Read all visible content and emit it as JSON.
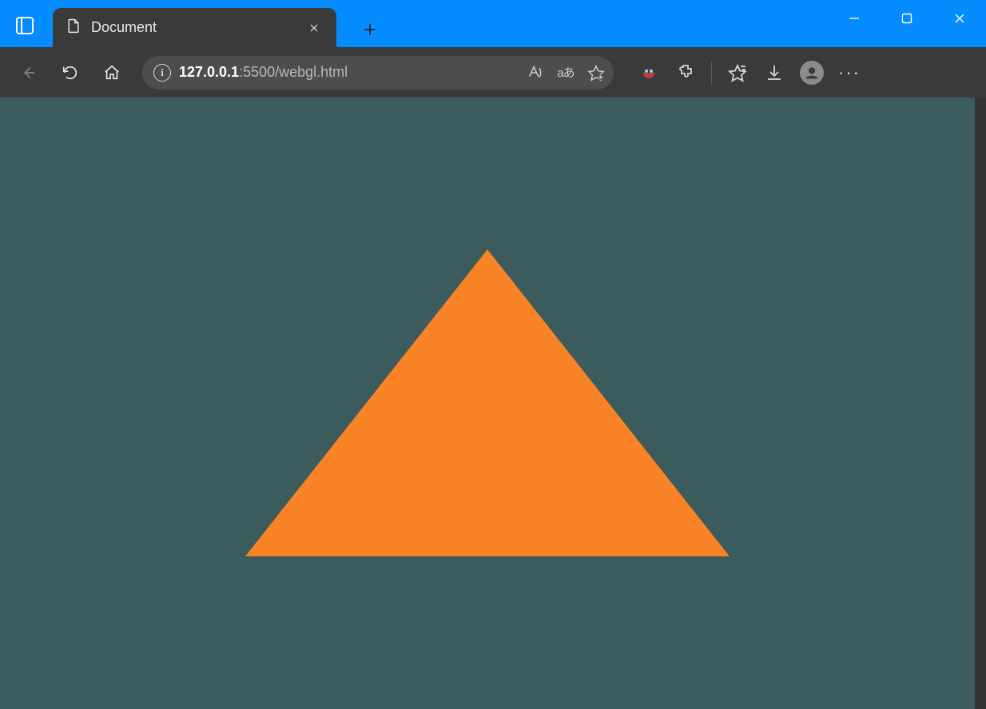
{
  "window": {
    "min_label": "Minimize",
    "max_label": "Maximize",
    "close_label": "Close"
  },
  "tab": {
    "title": "Document",
    "close_label": "Close tab",
    "new_tab_label": "New tab"
  },
  "toolbar": {
    "back_label": "Back",
    "refresh_label": "Refresh",
    "home_label": "Home",
    "info_glyph": "i",
    "read_aloud_label": "Read aloud",
    "translate_text": "aあ",
    "favorite_label": "Add to favorites",
    "bug_ext_label": "Extension",
    "extensions_label": "Extensions",
    "favorites_list_label": "Favorites",
    "downloads_label": "Downloads",
    "profile_label": "Profile",
    "more_label": "Settings and more"
  },
  "address": {
    "host": "127.0.0.1",
    "rest": ":5500/webgl.html"
  },
  "page": {
    "canvas_label": "WebGL canvas",
    "scrollbar_label": "Vertical scrollbar"
  },
  "colors": {
    "titlebar": "#058dff",
    "chrome": "#3a3a3a",
    "page_bg": "#3c5b5c",
    "triangle": "#f98327"
  }
}
